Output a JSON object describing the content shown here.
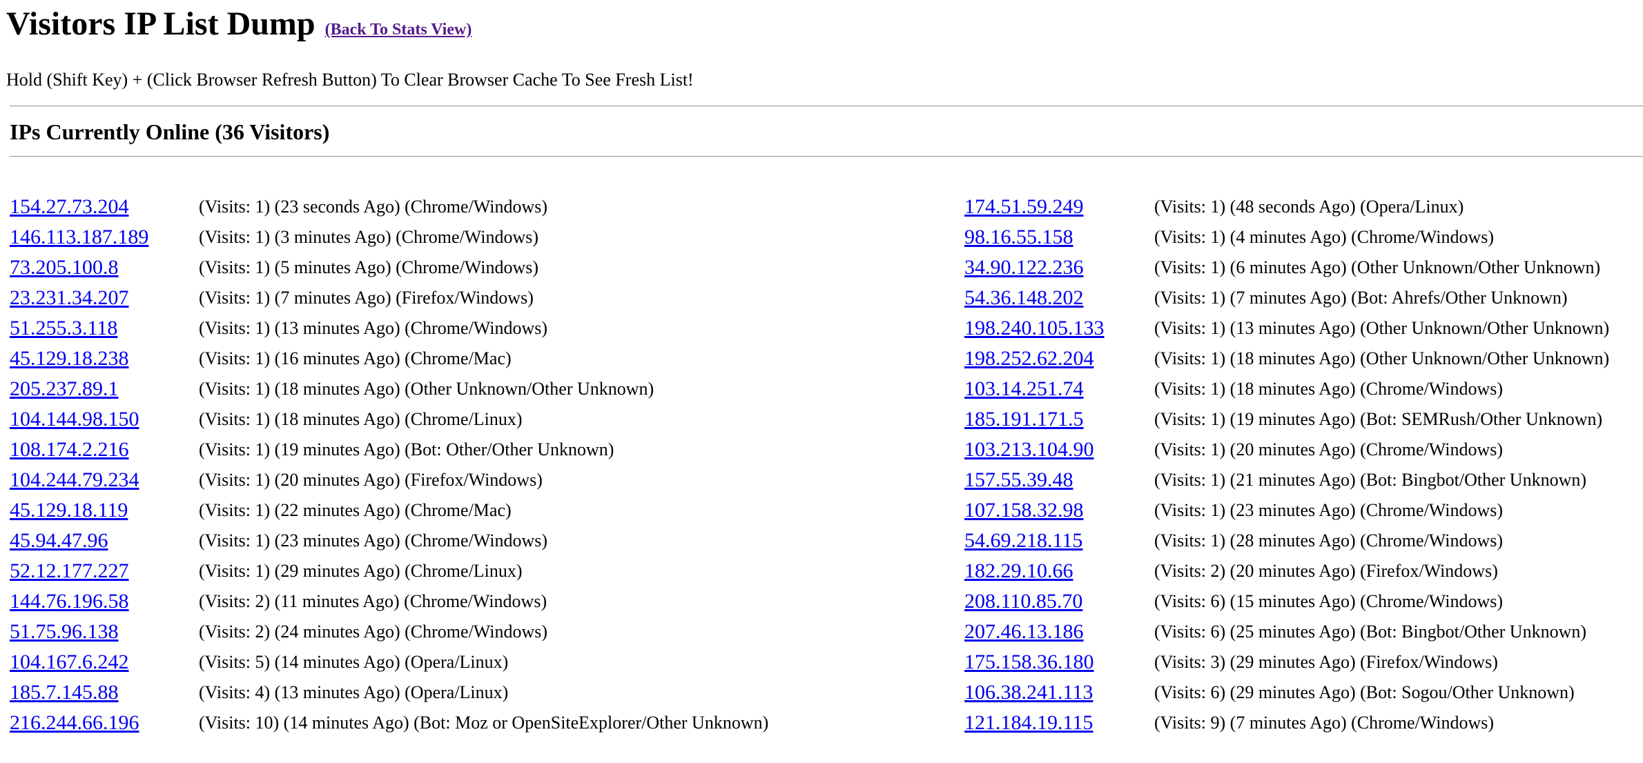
{
  "header": {
    "title": "Visitors IP List Dump",
    "back_link": "(Back To Stats View)"
  },
  "instructions": "Hold (Shift Key) + (Click Browser Refresh Button) To Clear Browser Cache To See Fresh List!",
  "section": {
    "heading": "IPs Currently Online (36 Visitors)"
  },
  "visitors_left": [
    {
      "ip": "154.27.73.204",
      "info": "(Visits: 1) (23 seconds Ago) (Chrome/Windows)"
    },
    {
      "ip": "146.113.187.189",
      "info": "(Visits: 1) (3 minutes Ago) (Chrome/Windows)"
    },
    {
      "ip": "73.205.100.8",
      "info": "(Visits: 1) (5 minutes Ago) (Chrome/Windows)"
    },
    {
      "ip": "23.231.34.207",
      "info": "(Visits: 1) (7 minutes Ago) (Firefox/Windows)"
    },
    {
      "ip": "51.255.3.118",
      "info": "(Visits: 1) (13 minutes Ago) (Chrome/Windows)"
    },
    {
      "ip": "45.129.18.238",
      "info": "(Visits: 1) (16 minutes Ago) (Chrome/Mac)"
    },
    {
      "ip": "205.237.89.1",
      "info": "(Visits: 1) (18 minutes Ago) (Other Unknown/Other Unknown)"
    },
    {
      "ip": "104.144.98.150",
      "info": "(Visits: 1) (18 minutes Ago) (Chrome/Linux)"
    },
    {
      "ip": "108.174.2.216",
      "info": "(Visits: 1) (19 minutes Ago) (Bot: Other/Other Unknown)"
    },
    {
      "ip": "104.244.79.234",
      "info": "(Visits: 1) (20 minutes Ago) (Firefox/Windows)"
    },
    {
      "ip": "45.129.18.119",
      "info": "(Visits: 1) (22 minutes Ago) (Chrome/Mac)"
    },
    {
      "ip": "45.94.47.96",
      "info": "(Visits: 1) (23 minutes Ago) (Chrome/Windows)"
    },
    {
      "ip": "52.12.177.227",
      "info": "(Visits: 1) (29 minutes Ago) (Chrome/Linux)"
    },
    {
      "ip": "144.76.196.58",
      "info": "(Visits: 2) (11 minutes Ago) (Chrome/Windows)"
    },
    {
      "ip": "51.75.96.138",
      "info": "(Visits: 2) (24 minutes Ago) (Chrome/Windows)"
    },
    {
      "ip": "104.167.6.242",
      "info": "(Visits: 5) (14 minutes Ago) (Opera/Linux)"
    },
    {
      "ip": "185.7.145.88",
      "info": "(Visits: 4) (13 minutes Ago) (Opera/Linux)"
    },
    {
      "ip": "216.244.66.196",
      "info": "(Visits: 10) (14 minutes Ago) (Bot: Moz or OpenSiteExplorer/Other Unknown)"
    }
  ],
  "visitors_right": [
    {
      "ip": "174.51.59.249",
      "info": "(Visits: 1) (48 seconds Ago) (Opera/Linux)"
    },
    {
      "ip": "98.16.55.158",
      "info": "(Visits: 1) (4 minutes Ago) (Chrome/Windows)"
    },
    {
      "ip": "34.90.122.236",
      "info": "(Visits: 1) (6 minutes Ago) (Other Unknown/Other Unknown)"
    },
    {
      "ip": "54.36.148.202",
      "info": "(Visits: 1) (7 minutes Ago) (Bot: Ahrefs/Other Unknown)"
    },
    {
      "ip": "198.240.105.133",
      "info": "(Visits: 1) (13 minutes Ago) (Other Unknown/Other Unknown)"
    },
    {
      "ip": "198.252.62.204",
      "info": "(Visits: 1) (18 minutes Ago) (Other Unknown/Other Unknown)"
    },
    {
      "ip": "103.14.251.74",
      "info": "(Visits: 1) (18 minutes Ago) (Chrome/Windows)"
    },
    {
      "ip": "185.191.171.5",
      "info": "(Visits: 1) (19 minutes Ago) (Bot: SEMRush/Other Unknown)"
    },
    {
      "ip": "103.213.104.90",
      "info": "(Visits: 1) (20 minutes Ago) (Chrome/Windows)"
    },
    {
      "ip": "157.55.39.48",
      "info": "(Visits: 1) (21 minutes Ago) (Bot: Bingbot/Other Unknown)"
    },
    {
      "ip": "107.158.32.98",
      "info": "(Visits: 1) (23 minutes Ago) (Chrome/Windows)"
    },
    {
      "ip": "54.69.218.115",
      "info": "(Visits: 1) (28 minutes Ago) (Chrome/Windows)"
    },
    {
      "ip": "182.29.10.66",
      "info": "(Visits: 2) (20 minutes Ago) (Firefox/Windows)"
    },
    {
      "ip": "208.110.85.70",
      "info": "(Visits: 6) (15 minutes Ago) (Chrome/Windows)"
    },
    {
      "ip": "207.46.13.186",
      "info": "(Visits: 6) (25 minutes Ago) (Bot: Bingbot/Other Unknown)"
    },
    {
      "ip": "175.158.36.180",
      "info": "(Visits: 3) (29 minutes Ago) (Firefox/Windows)"
    },
    {
      "ip": "106.38.241.113",
      "info": "(Visits: 6) (29 minutes Ago) (Bot: Sogou/Other Unknown)"
    },
    {
      "ip": "121.184.19.115",
      "info": "(Visits: 9) (7 minutes Ago) (Chrome/Windows)"
    }
  ],
  "colors": {
    "link": "#0000ee",
    "visited_link": "#551a8b",
    "divider": "#9a9a9a"
  }
}
